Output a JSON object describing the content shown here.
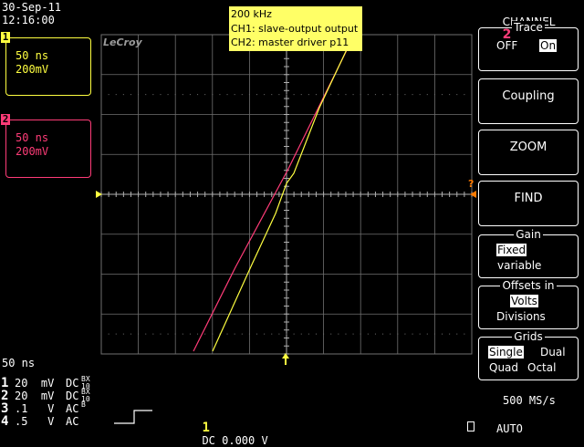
{
  "header": {
    "date": "30-Sep-11",
    "time": "12:16:00",
    "channel_label": "CHANNEL",
    "channel_num": "2"
  },
  "brand": "LeCroy",
  "ch1_box": {
    "num": "1",
    "timebase": "50 ns",
    "volts": "200mV",
    "color": "#ffff40"
  },
  "ch2_box": {
    "num": "2",
    "timebase": "50 ns",
    "volts": "200mV",
    "color": "#ff3c78"
  },
  "annotation": {
    "line1": "200 kHz",
    "line2": "CH1: slave-output output",
    "line3": "CH2: master driver p11"
  },
  "timebase_readout": "50 ns",
  "channel_table": [
    {
      "n": "1",
      "volts": "20  mV",
      "coupling": "DC",
      "bw": "B",
      "lim": "X",
      "sub": "10"
    },
    {
      "n": "2",
      "volts": "20  mV",
      "coupling": "DC",
      "bw": "B",
      "lim": "X",
      "sub": "10"
    },
    {
      "n": "3",
      "volts": ".1   V",
      "coupling": "AC",
      "bw": "B",
      "lim": "",
      "sub": ""
    },
    {
      "n": "4",
      "volts": ".5   V",
      "coupling": "AC",
      "bw": "",
      "lim": "",
      "sub": ""
    }
  ],
  "trigger": {
    "source": "1",
    "text": "DC 0.000 V"
  },
  "sample_rate": "500 MS/s",
  "trigger_mode": "AUTO",
  "menu": {
    "trace": {
      "title": "Trace",
      "off": "OFF",
      "on": "On"
    },
    "coupling": "Coupling",
    "zoom": "ZOOM",
    "find": "FIND",
    "gain": {
      "title": "Gain",
      "opt1": "Fixed",
      "opt2": "variable"
    },
    "offsets": {
      "title": "Offsets in",
      "opt1": "Volts",
      "opt2": "Divisions"
    },
    "grids": {
      "title": "Grids",
      "single": "Single",
      "dual": "Dual",
      "quad": "Quad",
      "octal": "Octal"
    }
  },
  "colors": {
    "ch1": "#ffff40",
    "ch2": "#ff3c78",
    "grid": "#707070",
    "background": "#000000"
  }
}
